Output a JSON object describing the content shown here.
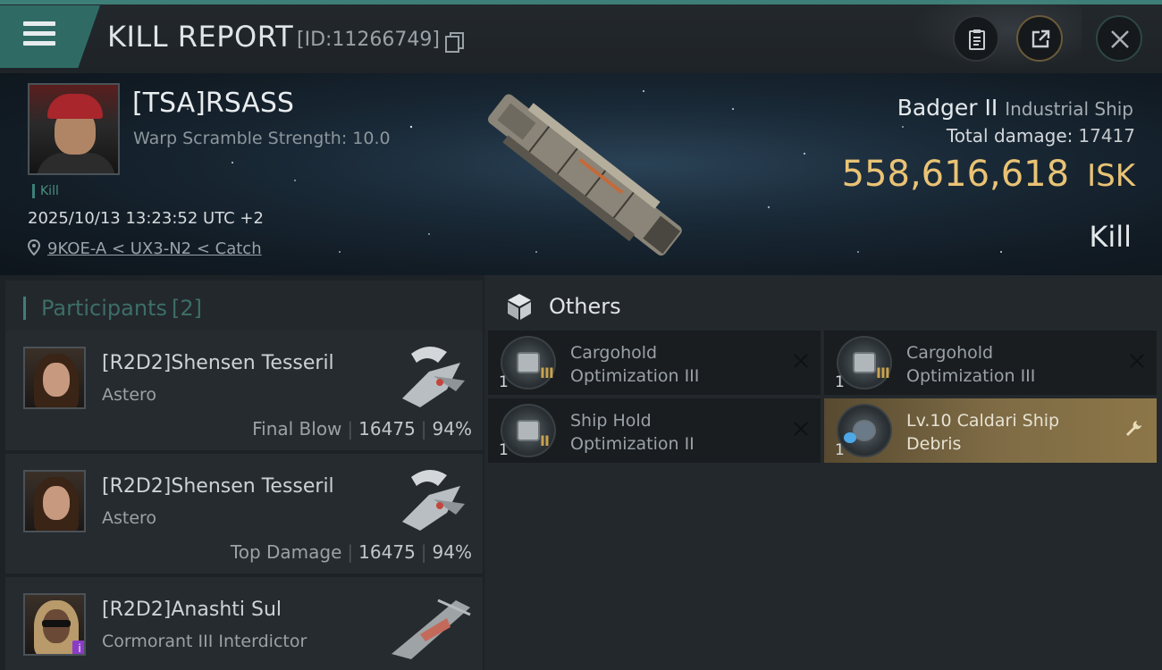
{
  "header": {
    "title": "KILL REPORT",
    "report_id": "[ID:11266749]",
    "icons": [
      "menu-icon",
      "copy-icon",
      "clipboard-icon",
      "share-icon",
      "close-icon"
    ]
  },
  "victim": {
    "pilot_name": "[TSA]RSASS",
    "warp_scramble": "Warp Scramble Strength: 10.0",
    "kill_tag": "Kill",
    "timestamp": "2025/10/13 13:23:52 UTC +2",
    "location": "9KOE-A < UX3-N2 < Catch",
    "ship_name": "Badger II",
    "ship_class": "Industrial Ship",
    "total_damage_label": "Total damage:",
    "total_damage": "17417",
    "isk_value": "558,616,618",
    "isk_unit": "ISK",
    "result": "Kill"
  },
  "participants": {
    "title": "Participants",
    "count": "[2]",
    "rows": [
      {
        "name": "[R2D2]Shensen Tesseril",
        "ship": "Astero",
        "role": "Final Blow",
        "damage": "16475",
        "percent": "94%"
      },
      {
        "name": "[R2D2]Shensen Tesseril",
        "ship": "Astero",
        "role": "Top Damage",
        "damage": "16475",
        "percent": "94%"
      },
      {
        "name": "[R2D2]Anashti Sul",
        "ship": "Cormorant III Interdictor",
        "badge": "i"
      }
    ]
  },
  "others": {
    "title": "Others",
    "items": [
      {
        "name_line1": "Cargohold",
        "name_line2": "Optimization III",
        "qty": "1",
        "tier": "III",
        "action": "close-icon"
      },
      {
        "name_line1": "Cargohold",
        "name_line2": "Optimization III",
        "qty": "1",
        "tier": "III",
        "action": "close-icon"
      },
      {
        "name_line1": "Ship Hold",
        "name_line2": "Optimization II",
        "qty": "1",
        "tier": "II",
        "action": "close-icon"
      },
      {
        "name_line1": "Lv.10 Caldari Ship",
        "name_line2": "Debris",
        "qty": "1",
        "action": "wrench-icon"
      }
    ]
  },
  "colors": {
    "accent_teal": "#3d7f78",
    "isk_gold": "#e9c375",
    "highlight_item": "#7e6b45"
  }
}
